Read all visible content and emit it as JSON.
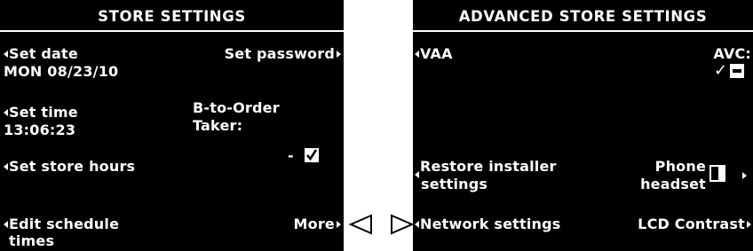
{
  "left_screen": {
    "title": "STORE SETTINGS",
    "set_date_label": "Set date",
    "set_date_value": "MON 08/23/10",
    "set_time_label": "Set time",
    "set_time_value": "13:06:23",
    "set_store_hours_label": "Set store hours",
    "edit_schedule_line1": "Edit schedule",
    "edit_schedule_line2": "times",
    "set_password_label": "Set password",
    "b_to_order_line1": "B-to-Order",
    "b_to_order_line2": "Taker:",
    "b_to_order_prefix": "-",
    "b_to_order_checked": true,
    "more_label": "More"
  },
  "right_screen": {
    "title": "ADVANCED STORE SETTINGS",
    "vaa_label": "VAA",
    "avc_label": "AVC:",
    "avc_check": "✓",
    "restore_line1": "Restore installer",
    "restore_line2": "settings",
    "phone_line1": "Phone",
    "phone_line2": "headset",
    "network_label": "Network settings",
    "lcd_contrast_label": "LCD Contrast"
  },
  "nav_arrows": {
    "back_icon": "triangle-left-outline-icon",
    "forward_icon": "triangle-right-outline-icon"
  },
  "colors": {
    "screen_bg": "#000000",
    "screen_text": "#ffffff",
    "page_bg": "#ffffff"
  }
}
